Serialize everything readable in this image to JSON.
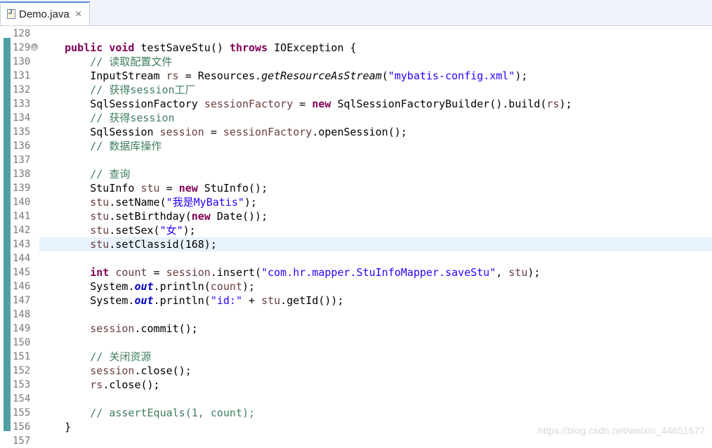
{
  "tab": {
    "title": "Demo.java",
    "close": "✕",
    "icon": "java-file-icon"
  },
  "lines": [
    {
      "n": "128",
      "code": ""
    },
    {
      "n": "129",
      "code": "    public void testSaveStu() throws IOException {"
    },
    {
      "n": "130",
      "code": "        // 读取配置文件"
    },
    {
      "n": "131",
      "code": "        InputStream rs = Resources.getResourceAsStream(\"mybatis-config.xml\");"
    },
    {
      "n": "132",
      "code": "        // 获得session工厂"
    },
    {
      "n": "133",
      "code": "        SqlSessionFactory sessionFactory = new SqlSessionFactoryBuilder().build(rs);"
    },
    {
      "n": "134",
      "code": "        // 获得session"
    },
    {
      "n": "135",
      "code": "        SqlSession session = sessionFactory.openSession();"
    },
    {
      "n": "136",
      "code": "        // 数据库操作"
    },
    {
      "n": "137",
      "code": ""
    },
    {
      "n": "138",
      "code": "        // 查询"
    },
    {
      "n": "139",
      "code": "        StuInfo stu = new StuInfo();"
    },
    {
      "n": "140",
      "code": "        stu.setName(\"我是MyBatis\");"
    },
    {
      "n": "141",
      "code": "        stu.setBirthday(new Date());"
    },
    {
      "n": "142",
      "code": "        stu.setSex(\"女\");"
    },
    {
      "n": "143",
      "code": "        stu.setClassid(168);"
    },
    {
      "n": "144",
      "code": ""
    },
    {
      "n": "145",
      "code": "        int count = session.insert(\"com.hr.mapper.StuInfoMapper.saveStu\", stu);"
    },
    {
      "n": "146",
      "code": "        System.out.println(count);"
    },
    {
      "n": "147",
      "code": "        System.out.println(\"id:\" + stu.getId());"
    },
    {
      "n": "148",
      "code": ""
    },
    {
      "n": "149",
      "code": "        session.commit();"
    },
    {
      "n": "150",
      "code": ""
    },
    {
      "n": "151",
      "code": "        // 关闭资源"
    },
    {
      "n": "152",
      "code": "        session.close();"
    },
    {
      "n": "153",
      "code": "        rs.close();"
    },
    {
      "n": "154",
      "code": ""
    },
    {
      "n": "155",
      "code": "        // assertEquals(1, count);"
    },
    {
      "n": "156",
      "code": "    }"
    },
    {
      "n": "157",
      "code": ""
    }
  ],
  "fold_marker": "⊖",
  "watermark": "https://blog.csdn.net/weixin_44651677",
  "colors": {
    "keyword": "#7f0055",
    "comment": "#3f7f5f",
    "string": "#2a00ff",
    "field": "#0000c0",
    "variable": "#6a3e3e"
  }
}
